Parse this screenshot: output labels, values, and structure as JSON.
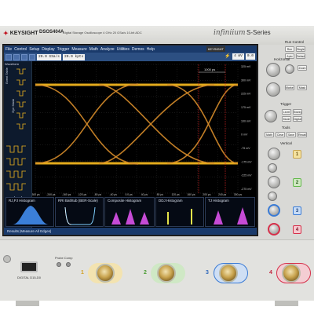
{
  "header": {
    "brand": "KEYSIGHT",
    "model": "DSOS404A",
    "description": "Digital Storage Oscilloscope  4 GHz  20 GSa/s  10-bit ADC",
    "product_line": "infiniium",
    "series": "S-Series"
  },
  "menu": {
    "items": [
      "File",
      "Control",
      "Setup",
      "Display",
      "Trigger",
      "Measure",
      "Math",
      "Analyze",
      "Utilities",
      "Demos",
      "Help"
    ],
    "badge": "KEYSIGHT"
  },
  "toolbar": {
    "sample_rate": "20.0 GSa/s",
    "memory_depth": "20.0 kpts",
    "time_field": "4 mV",
    "trigger_field": "0.0"
  },
  "sidebar": {
    "title": "Waveform",
    "tab_one": "Event Table",
    "tab_two": "Eye Mask"
  },
  "plot": {
    "x_ticks": [
      "-300 ps",
      "-240 ps",
      "-160 ps",
      "-120 ps",
      "-80 ps",
      "-40 ps",
      "0.0 ps",
      "40 ps",
      "80 ps",
      "120 ps",
      "160 ps",
      "200 ps",
      "240 ps",
      "300 ps"
    ],
    "y_ticks": [
      "325 mV",
      "300 mV",
      "225 mV",
      "175 mV",
      "100 mV",
      "0 mV",
      "-75 mV",
      "-175 mV",
      "-225 mV",
      "-275 mV"
    ],
    "marker_label": "1000 ps",
    "colors": {
      "trace": "#f0b41e",
      "cross": "#d68c2a",
      "grid": "#2e2e2e",
      "marker": "#cc2222"
    }
  },
  "histograms": [
    {
      "title": "RJ,PJ Histogram"
    },
    {
      "title": "RRI Bathtub (BER-Scale)"
    },
    {
      "title": "Composite Histogram"
    },
    {
      "title": "DDJ Histogram"
    },
    {
      "title": "TJ Histogram"
    }
  ],
  "results_bar": {
    "label": "Results   |Measure All Edges|"
  },
  "right_panel": {
    "run_control": "Run Control",
    "horizontal": "Horizontal",
    "trigger": "Trigger",
    "tools": "Tools",
    "vertical": "Vertical",
    "buttons": {
      "run": "Run Stop",
      "single": "Single",
      "auto": "Auto Scale",
      "default": "Default Setup",
      "zoom": "Zoom",
      "level": "Level",
      "sweep": "Sweep",
      "mode": "Mode",
      "marker": "Marker",
      "mask": "Mask",
      "digital": "Digital",
      "math": "Math",
      "clear": "Clear Display",
      "save": "Save",
      "recall": "Recall"
    },
    "channels": [
      "1",
      "2",
      "3",
      "4"
    ]
  },
  "bottom": {
    "usb_label": "DIGITAL D15-D0",
    "probe_label": "Probe Comp",
    "channels": [
      {
        "num": "1",
        "color": "#e3b32b"
      },
      {
        "num": "2",
        "color": "#62b84a"
      },
      {
        "num": "3",
        "color": "#3a7bd5"
      },
      {
        "num": "4",
        "color": "#d6304a"
      }
    ]
  }
}
